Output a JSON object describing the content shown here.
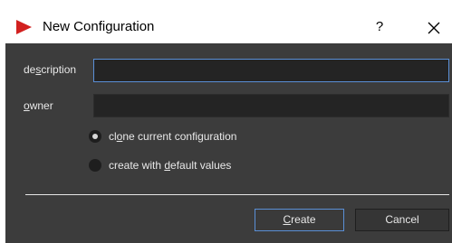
{
  "window": {
    "title": "New Configuration",
    "help_label": "?",
    "close_label": "×"
  },
  "form": {
    "description": {
      "label_pre": "de",
      "label_mnemonic": "s",
      "label_post": "cription",
      "value": ""
    },
    "owner": {
      "label_pre": "",
      "label_mnemonic": "o",
      "label_post": "wner",
      "value": ""
    }
  },
  "options": {
    "clone": {
      "label_pre": "cl",
      "label_mnemonic": "o",
      "label_post": "ne current configuration",
      "checked": true
    },
    "defaults": {
      "label_pre": "create with ",
      "label_mnemonic": "d",
      "label_post": "efault values",
      "checked": false
    }
  },
  "buttons": {
    "create": {
      "label_pre": "",
      "label_mnemonic": "C",
      "label_post": "reate"
    },
    "cancel_label": "Cancel"
  },
  "colors": {
    "accent": "#5a8fd6",
    "app_icon": "#d2201f",
    "panel": "#3c3c3c"
  }
}
